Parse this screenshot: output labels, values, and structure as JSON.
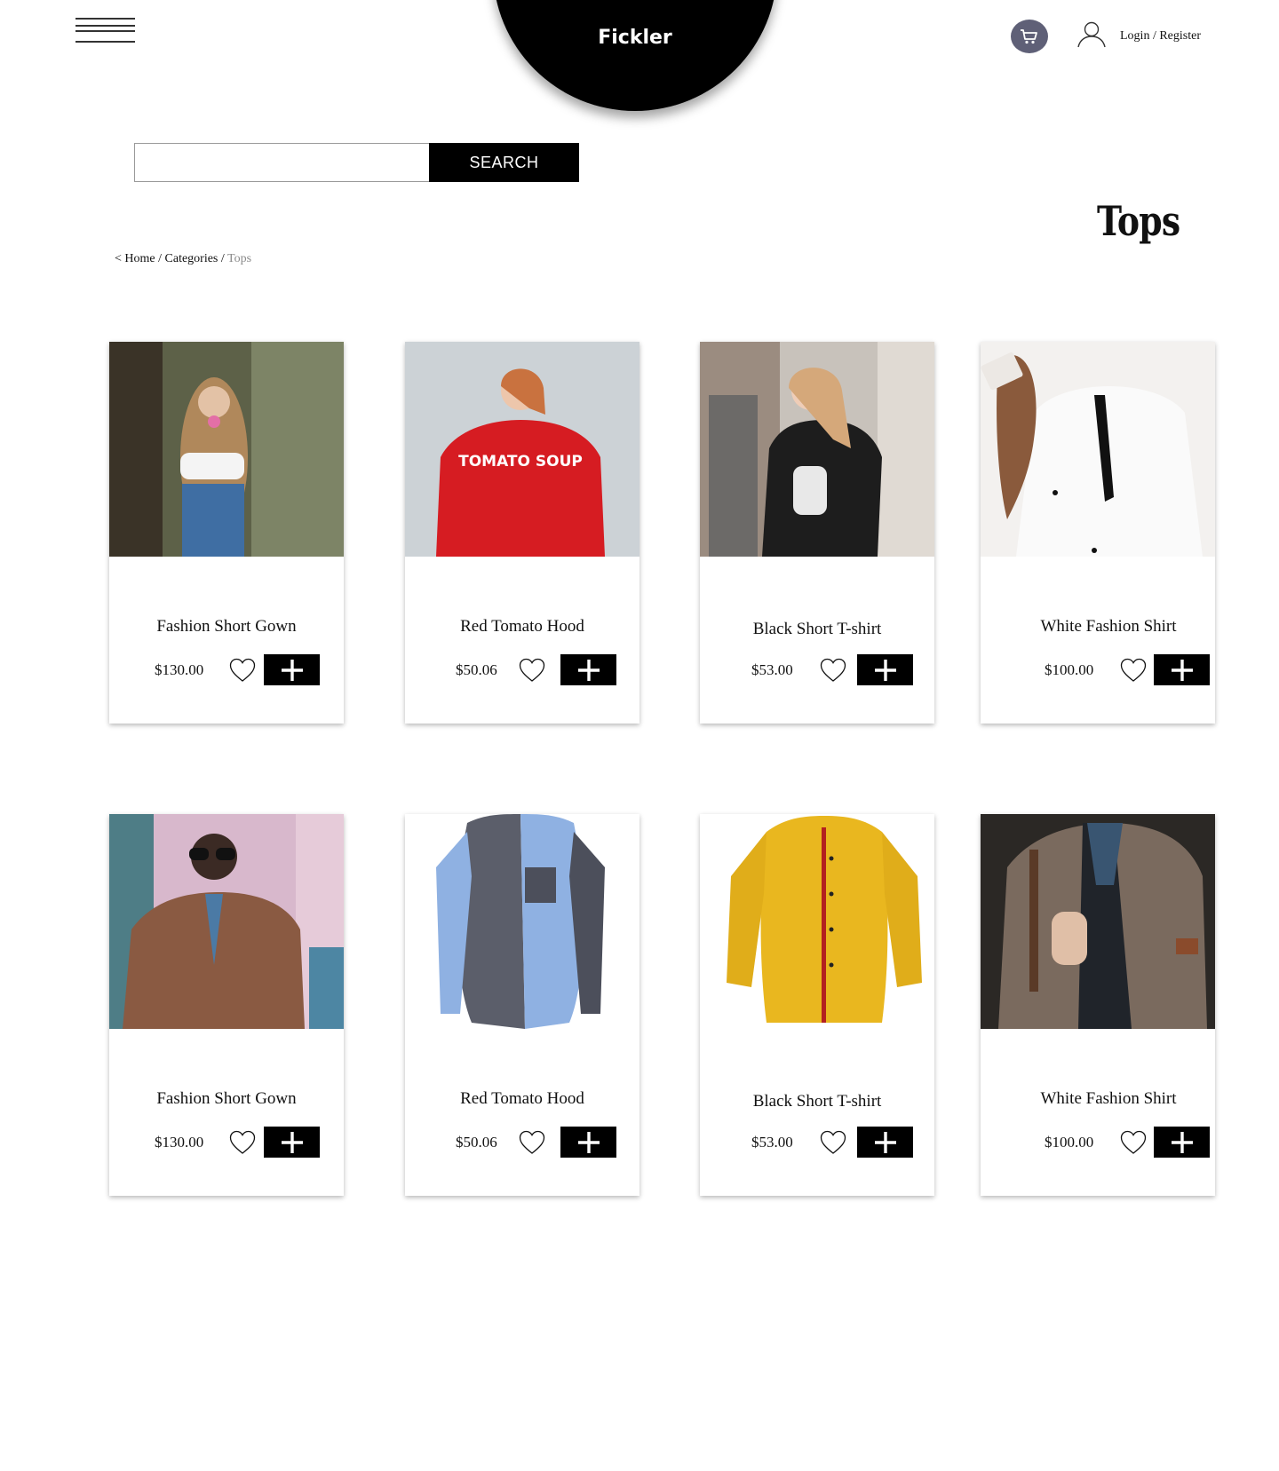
{
  "header": {
    "brand": "Fickler",
    "auth_link": "Login / Register"
  },
  "search": {
    "placeholder": "",
    "button_label": "SEARCH"
  },
  "page": {
    "title": "Tops"
  },
  "breadcrumb": {
    "back": "<",
    "home": "Home",
    "sep1": "/",
    "categories": "Categories",
    "sep2": "/",
    "current": "Tops"
  },
  "products": [
    {
      "name": "Fashion Short Gown",
      "price": "$130.00"
    },
    {
      "name": "Red Tomato Hood",
      "price": "$50.06"
    },
    {
      "name": "Black Short T-shirt",
      "price": "$53.00"
    },
    {
      "name": "White Fashion Shirt",
      "price": "$100.00"
    },
    {
      "name": "Fashion Short Gown",
      "price": "$130.00"
    },
    {
      "name": "Red Tomato Hood",
      "price": "$50.06"
    },
    {
      "name": "Black Short T-shirt",
      "price": "$53.00"
    },
    {
      "name": "White Fashion Shirt",
      "price": "$100.00"
    }
  ],
  "product_images": [
    {
      "print": ""
    },
    {
      "print": "TOMATO SOUP"
    },
    {
      "print": ""
    },
    {
      "print": ""
    },
    {
      "print": ""
    },
    {
      "print": ""
    },
    {
      "print": ""
    },
    {
      "print": ""
    }
  ],
  "colors": {
    "accent": "#000000",
    "cart_badge": "#5f6077",
    "breadcrumb_current": "#8a8a8a"
  },
  "icons": {
    "menu": "hamburger-menu-icon",
    "cart": "cart-icon",
    "user": "user-icon",
    "favorite": "heart-icon",
    "add": "plus-icon"
  }
}
